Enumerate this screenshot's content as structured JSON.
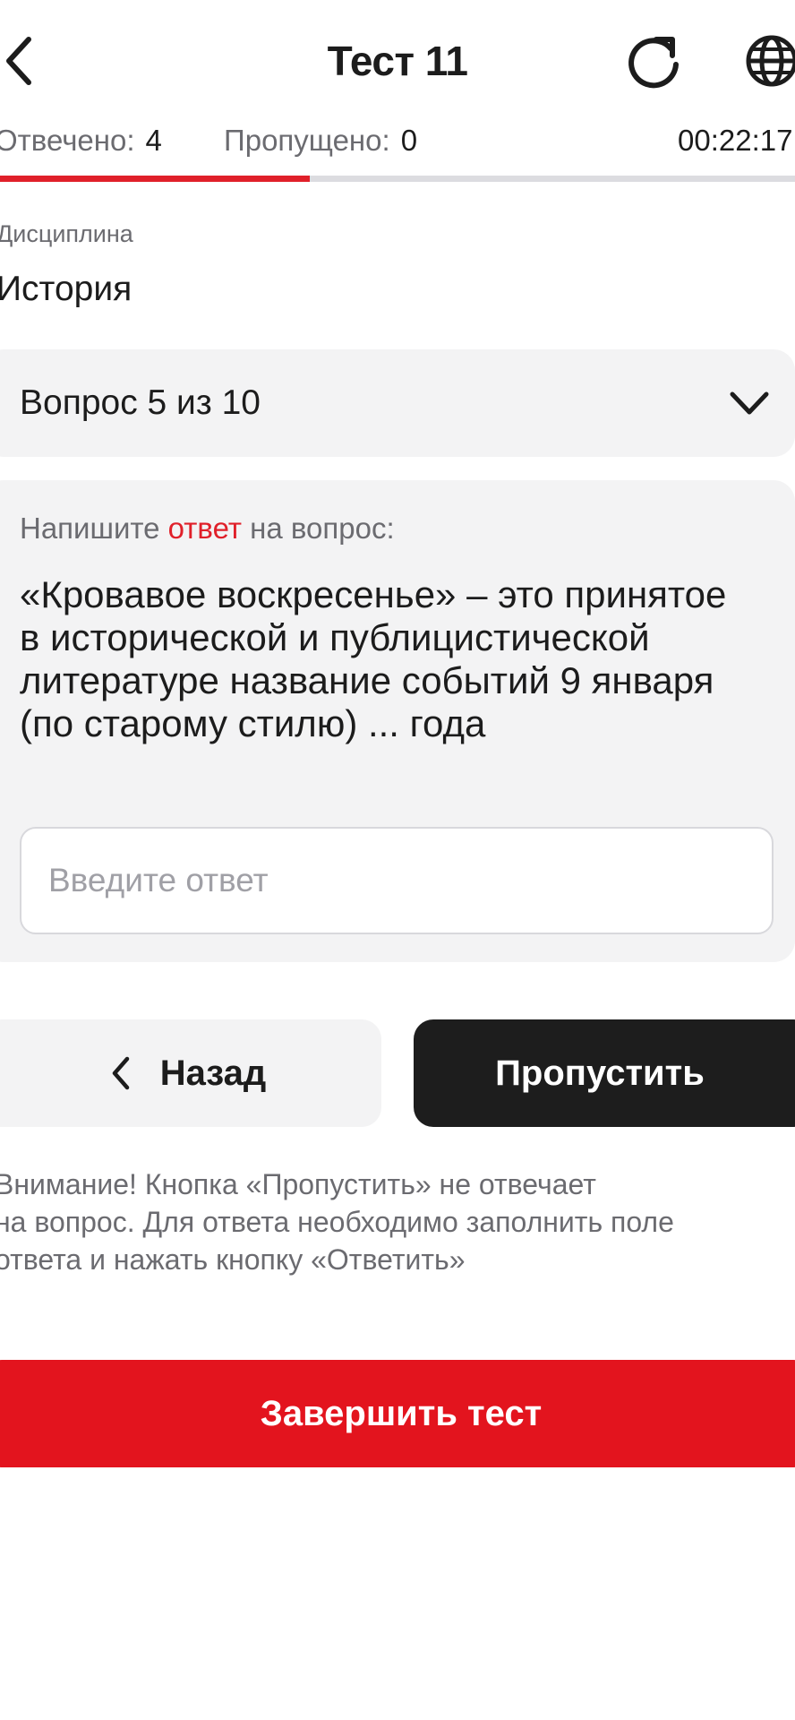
{
  "header": {
    "title": "Тест 11",
    "icons": {
      "back": "chevron-left-icon",
      "refresh": "refresh-icon",
      "language": "globe-icon"
    }
  },
  "stats": {
    "answered_label": "Отвечено:",
    "answered_value": "4",
    "skipped_label": "Пропущено:",
    "skipped_value": "0",
    "timer": "00:22:17"
  },
  "progress": {
    "fraction": 0.39
  },
  "discipline": {
    "label": "Дисциплина",
    "value": "История"
  },
  "question_selector": {
    "label": "Вопрос 5 из 10",
    "icon": "chevron-down-icon"
  },
  "question": {
    "prompt_before": "Напишите ",
    "prompt_accent": "ответ",
    "prompt_after": " на вопрос:",
    "text": "«Кровавое воскресенье» – это принятое в исторической и публицистической литературе название событий 9 января (по старому стилю) ... года",
    "input_placeholder": "Введите ответ",
    "input_value": ""
  },
  "actions": {
    "back_label": "Назад",
    "skip_label": "Пропустить",
    "finish_label": "Завершить тест"
  },
  "warning": "Внимание! Кнопка «Пропустить» не отвечает\nна вопрос. Для ответа необходимо заполнить поле\nответа и нажать кнопку «Ответить»",
  "colors": {
    "accent": "#e0202a",
    "finish_button": "#e3141e",
    "skip_button": "#1d1d1d",
    "card_bg": "#f3f3f4",
    "muted_text": "#6b6b70",
    "progress_track": "#dcdce0"
  }
}
